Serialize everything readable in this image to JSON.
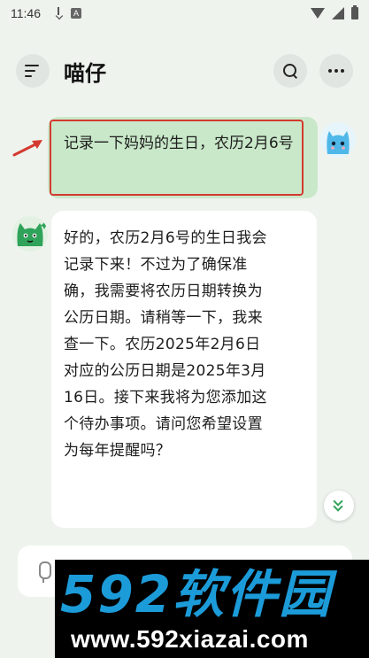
{
  "status_bar": {
    "time": "11:46",
    "icons": [
      "download-icon",
      "a-badge-icon",
      "wifi-icon",
      "signal-icon",
      "battery-icon"
    ]
  },
  "header": {
    "title": "喵仔",
    "menu_icon": "menu-icon",
    "search_icon": "search-icon",
    "more_icon": "more-icon"
  },
  "conversation": {
    "user_message": {
      "text": "记录一下妈妈的生日，农历2月6号",
      "highlight_color": "#d43a2f",
      "avatar": "blue-cat-avatar"
    },
    "bot_message": {
      "text": "好的，农历2月6号的生日我会记录下来！不过为了确保准确，我需要将农历日期转换为公历日期。请稍等一下，我来查一下。农历2025年2月6日对应的公历日期是2025年3月16日。接下来我将为您添加这个待办事项。请问您希望设置为每年提醒吗？",
      "avatar": "green-cat-avatar"
    }
  },
  "input_bar": {
    "mic_icon": "mic-icon"
  },
  "watermark": {
    "logo_text": "592软件园",
    "url": "www.592xiazai.com"
  },
  "colors": {
    "background": "#eef3ee",
    "user_bubble": "#c9e8c9",
    "bot_bubble": "#ffffff",
    "accent_green": "#2fa35a",
    "watermark_blue": "#1c9bd9"
  }
}
